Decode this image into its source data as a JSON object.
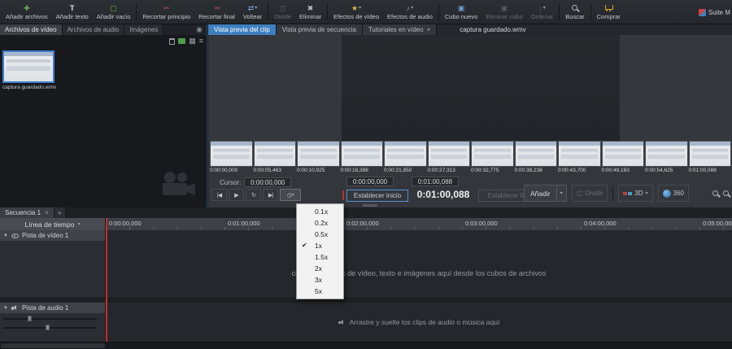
{
  "colors": {
    "accent_blue": "#3f7fbf",
    "playhead_red": "#c23030",
    "selection_blue": "#3f7fd0",
    "menu_bg": "#f2f2f2"
  },
  "icons": {
    "add_files": "✚",
    "add_text": "T",
    "add_blank": "▢",
    "trim_start": "✂",
    "trim_end": "✂",
    "flip": "⇄",
    "split": "◫",
    "delete": "✖",
    "video_fx": "★",
    "audio_fx": "♪",
    "new_bin": "▣",
    "delete_bin": "▣",
    "sort": "↕",
    "dropdown": "▾",
    "collapse": "▼",
    "close": "×",
    "add_tab": "+",
    "skip_start": "|◀",
    "play": "▶",
    "loop": "↻",
    "skip_end": "▶|",
    "speed_clock": "◷",
    "check": "✔",
    "grid_view": "▦",
    "list_view": "≡",
    "camera": "◉"
  },
  "toolbar": {
    "items": [
      {
        "label": "Añadir archivos"
      },
      {
        "label": "Añadir texto"
      },
      {
        "label": "Añadir vacío"
      },
      {
        "label": "Recortar principio"
      },
      {
        "label": "Recortar final"
      },
      {
        "label": "Voltear"
      },
      {
        "label": "Divide"
      },
      {
        "label": "Eliminar"
      },
      {
        "label": "Efectos de vídeo"
      },
      {
        "label": "Efectos de audio"
      },
      {
        "label": "Cubo nuevo"
      },
      {
        "label": "Eliminar cubo"
      },
      {
        "label": "Ordenar"
      },
      {
        "label": "Buscar"
      },
      {
        "label": "Comprar"
      }
    ],
    "suite_label": "Suite M"
  },
  "left_panel": {
    "tabs": [
      "Archivos de vídeo",
      "Archivos de audio",
      "Imágenes"
    ],
    "file_name": "captura guardado.wmv"
  },
  "preview": {
    "tabs": [
      "Vista previa del clip",
      "Vista previa de secuencia",
      "Tutoriales en vídeo"
    ],
    "title": "captura guardado.wmv",
    "filmstrip": [
      "0:00:00,000",
      "0:00:05,463",
      "0:00:10,925",
      "0:00:16,388",
      "0:00:21,850",
      "0:00:27,313",
      "0:00:32,775",
      "0:00:38,238",
      "0:00:43,700",
      "0:00:49,163",
      "0:00:54,625",
      "0:01:00,088"
    ],
    "cursor_label": "Cursor:",
    "cursor_value": "0:00:00,000",
    "start_value": "0:00:00,000",
    "end_value": "0:01:00,088",
    "big_time": "0:01:00,088",
    "set_start_label": "Establecer inicio",
    "set_end_label": "Establecer fin",
    "add_label": "Añadir",
    "divide_label": "Divide",
    "threed_label": "3D",
    "v360_label": "360"
  },
  "speed_menu": {
    "items": [
      "0.1x",
      "0.2x",
      "0.5x",
      "1x",
      "1.5x",
      "2x",
      "3x",
      "5x"
    ],
    "checked": "1x"
  },
  "timeline": {
    "sequence_tab": "Secuencia 1",
    "header_label": "Línea de tiempo",
    "ruler": [
      "0:00:00,000",
      "0:01:00,000",
      "0:02:00,000",
      "0:03:00,000",
      "0:04:00,000",
      "0:05:00,000"
    ],
    "video_track": {
      "name": "Pista de vídeo 1",
      "hint": "coloque los clips de vídeo, texto e imágenes aquí desde los cubos de archivos"
    },
    "audio_track": {
      "name": "Pista de audio 1",
      "hint": "Arrastre y suelte los clips de audio o música aquí"
    }
  }
}
